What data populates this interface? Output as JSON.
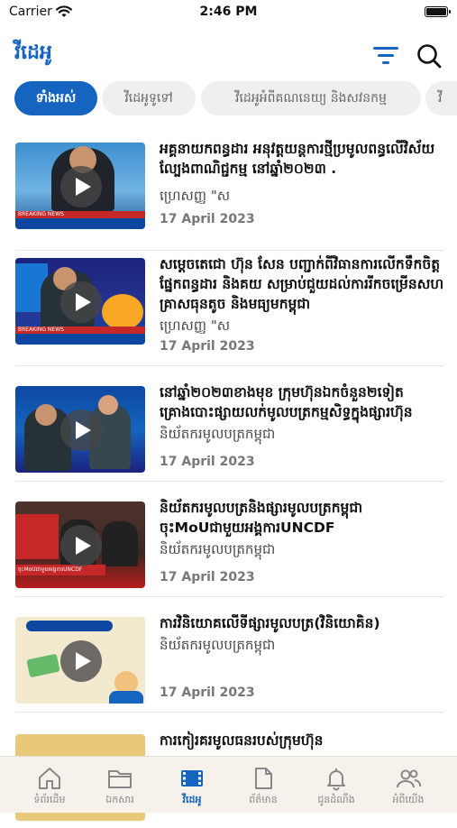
{
  "status_bar": {
    "carrier": "Carrier",
    "time": "2:46 PM"
  },
  "header": {
    "title": "វីដេអូ",
    "icons": [
      "filter-icon",
      "search-icon"
    ]
  },
  "chips": [
    {
      "label": "ទាំងអស់",
      "active": true
    },
    {
      "label": "វីដេអូទូទៅ",
      "active": false
    },
    {
      "label": "វីដេអូអំពីគណនេយ្យ និងសវនកម្ម",
      "active": false
    },
    {
      "label": "វី",
      "active": false
    }
  ],
  "videos": [
    {
      "title": "អគ្គនាយកពន្ធដារ អនុវត្តយន្តការថ្មីប្រមូលពន្ធលើវិស័យល្បែងពាណិជ្ជកម្ម នៅឆ្នាំ២០២៣ .",
      "source": "ហ្រេសញ្ញ \"ស",
      "date": "17 April 2023"
    },
    {
      "title": "សម្តេចតេជោ ហ៊ុន សែន បញ្ជាក់ពីវិធានការលើកទឹកចិត្តផ្នែកពន្ធដារ និងគយ សម្រាប់ជួយដល់ការរីកចម្រើនសហគ្រាសធុនតូច និងមធ្យមកម្ពុជា",
      "source": "ហ្រេសញ្ញ \"ស",
      "date": "17 April 2023"
    },
    {
      "title": "នៅឆ្នាំ២០២៣ខាងមុខ ក្រុមហ៊ុនឯកចំនួន២ទៀត គ្រោងបោះផ្សាយលក់មូលបត្រកម្មសិទ្ធក្នុងផ្សារហ៊ុន",
      "source": "និយ័តករមូលបត្រកម្ពុជា",
      "date": "17 April 2023"
    },
    {
      "title": "និយ័តករមូលបត្រនិងផ្សារមូលបត្រកម្ពុជា ចុះMoUជាមួយអង្គការUNCDF",
      "source": "និយ័តករមូលបត្រកម្ពុជា",
      "date": "17 April 2023"
    },
    {
      "title": "ការវិនិយោគលើទីផ្សារមូលបត្រ(វិនិយោគិន)",
      "source": "និយ័តករមូលបត្រកម្ពុជា",
      "date": "17 April 2023"
    },
    {
      "title": "ការកៀរគរមូលធនរបស់ក្រុមហ៊ុន",
      "source": "",
      "date": ""
    }
  ],
  "thumbnails": [
    {
      "caption": "BREAKING NEWS"
    },
    {
      "caption": "BREAKING NEWS"
    },
    {
      "caption": ""
    },
    {
      "caption": "ចុះMoUជាមួយអង្គការUNCDF"
    },
    {
      "caption": ""
    },
    {
      "caption": ""
    }
  ],
  "tabbar": [
    {
      "label": "ទំព័រដើម",
      "icon": "home-icon",
      "active": false
    },
    {
      "label": "ឯកសារ",
      "icon": "folder-icon",
      "active": false
    },
    {
      "label": "វីដេអូ",
      "icon": "video-icon",
      "active": true
    },
    {
      "label": "ព័ត៌មាន",
      "icon": "document-icon",
      "active": false
    },
    {
      "label": "ជូនដំណឹង",
      "icon": "bell-icon",
      "active": false
    },
    {
      "label": "អំពីយើង",
      "icon": "people-icon",
      "active": false
    }
  ],
  "colors": {
    "accent": "#1565c0",
    "tabbar_bg": "#f6f1ea",
    "chip_bg": "#eeeff1"
  }
}
